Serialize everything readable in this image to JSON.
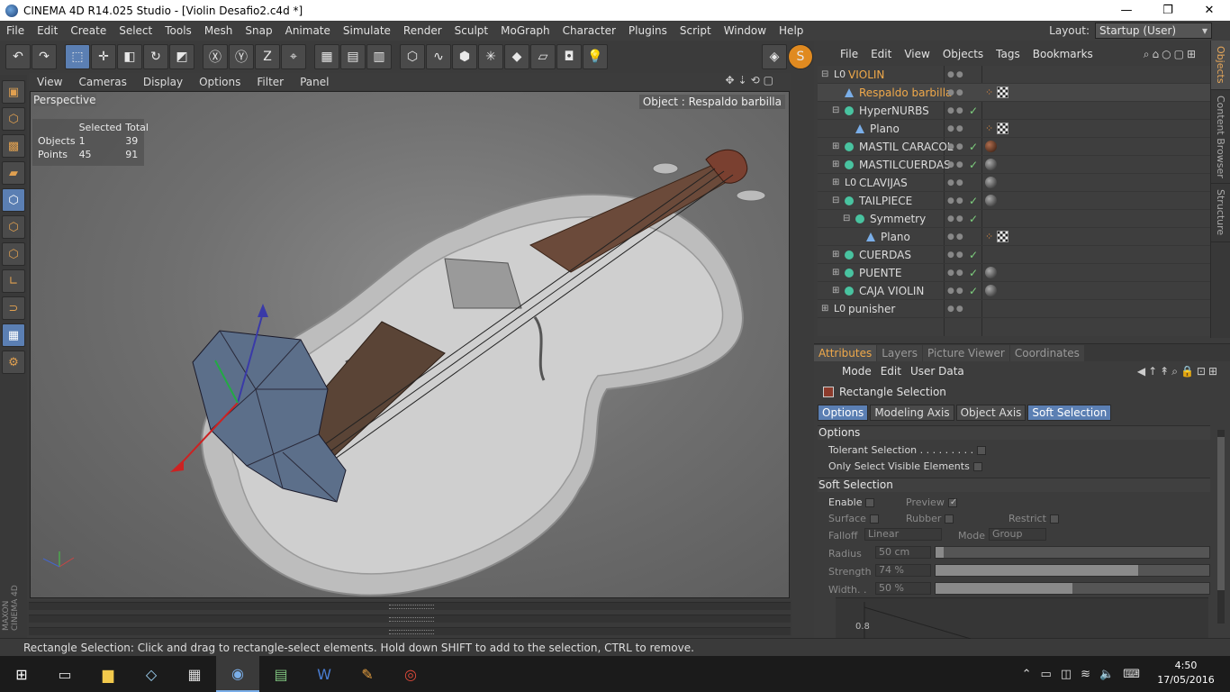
{
  "window": {
    "title": "CINEMA 4D R14.025 Studio - [Violin Desafio2.c4d *]",
    "minimize": "—",
    "maximize": "❐",
    "close": "✕"
  },
  "menubar": [
    "File",
    "Edit",
    "Create",
    "Select",
    "Tools",
    "Mesh",
    "Snap",
    "Animate",
    "Simulate",
    "Render",
    "Sculpt",
    "MoGraph",
    "Character",
    "Plugins",
    "Script",
    "Window",
    "Help"
  ],
  "layout": {
    "label": "Layout:",
    "value": "Startup (User)"
  },
  "viewport": {
    "menu": [
      "View",
      "Cameras",
      "Display",
      "Options",
      "Filter",
      "Panel"
    ],
    "label": "Perspective",
    "object_label": "Object : Respaldo barbilla",
    "stats": {
      "header_selected": "Selected",
      "header_total": "Total",
      "rows": [
        {
          "label": "Objects",
          "selected": "1",
          "total": "39"
        },
        {
          "label": "Points",
          "selected": "45",
          "total": "91"
        }
      ]
    },
    "brand": "MAXON CINEMA 4D"
  },
  "object_manager": {
    "menu": [
      "File",
      "Edit",
      "View",
      "Objects",
      "Tags",
      "Bookmarks"
    ],
    "side_tabs": [
      "Objects",
      "Content Browser",
      "Structure"
    ],
    "objects": [
      {
        "name": "VIOLIN",
        "indent": 0,
        "icon": "null",
        "expand": "⊟",
        "highlight": true,
        "check": "",
        "tags": []
      },
      {
        "name": "Respaldo barbilla",
        "indent": 1,
        "icon": "poly",
        "expand": "",
        "highlight": true,
        "check": "",
        "tags": [
          "phong",
          "chk"
        ]
      },
      {
        "name": "HyperNURBS",
        "indent": 1,
        "icon": "gen",
        "expand": "⊟",
        "highlight": false,
        "check": "✓",
        "tags": []
      },
      {
        "name": "Plano",
        "indent": 2,
        "icon": "poly",
        "expand": "",
        "highlight": false,
        "check": "",
        "tags": [
          "phong",
          "chk"
        ]
      },
      {
        "name": "MASTIL CARACOL",
        "indent": 1,
        "icon": "gen",
        "expand": "⊞",
        "highlight": false,
        "check": "✓",
        "tags": [
          "brown"
        ]
      },
      {
        "name": "MASTILCUERDAS",
        "indent": 1,
        "icon": "gen",
        "expand": "⊞",
        "highlight": false,
        "check": "✓",
        "tags": [
          "dark"
        ]
      },
      {
        "name": "CLAVIJAS",
        "indent": 1,
        "icon": "null",
        "expand": "⊞",
        "highlight": false,
        "check": "",
        "tags": [
          "dark"
        ]
      },
      {
        "name": "TAILPIECE",
        "indent": 1,
        "icon": "gen",
        "expand": "⊟",
        "highlight": false,
        "check": "✓",
        "tags": [
          "dark"
        ]
      },
      {
        "name": "Symmetry",
        "indent": 2,
        "icon": "gen",
        "expand": "⊟",
        "highlight": false,
        "check": "✓",
        "tags": []
      },
      {
        "name": "Plano",
        "indent": 3,
        "icon": "poly",
        "expand": "",
        "highlight": false,
        "check": "",
        "tags": [
          "phong",
          "chk"
        ]
      },
      {
        "name": "CUERDAS",
        "indent": 1,
        "icon": "gen",
        "expand": "⊞",
        "highlight": false,
        "check": "✓",
        "tags": []
      },
      {
        "name": "PUENTE",
        "indent": 1,
        "icon": "gen",
        "expand": "⊞",
        "highlight": false,
        "check": "✓",
        "tags": [
          "dark"
        ]
      },
      {
        "name": "CAJA VIOLIN",
        "indent": 1,
        "icon": "gen",
        "expand": "⊞",
        "highlight": false,
        "check": "✓",
        "tags": [
          "dark"
        ]
      },
      {
        "name": "punisher",
        "indent": 0,
        "icon": "null",
        "expand": "⊞",
        "highlight": false,
        "check": "",
        "tags": []
      }
    ]
  },
  "attributes": {
    "tabs": [
      "Attributes",
      "Layers",
      "Picture Viewer",
      "Coordinates"
    ],
    "menu": [
      "Mode",
      "Edit",
      "User Data"
    ],
    "tool_title": "Rectangle Selection",
    "subtabs": [
      "Options",
      "Modeling Axis",
      "Object Axis",
      "Soft Selection"
    ],
    "options_header": "Options",
    "tolerant": "Tolerant Selection . . . . . . . . .",
    "only_visible": "Only Select Visible Elements",
    "soft_header": "Soft Selection",
    "enable": "Enable",
    "preview": "Preview",
    "surface": "Surface",
    "rubber": "Rubber",
    "restrict": "Restrict",
    "falloff_label": "Falloff",
    "falloff_value": "Linear",
    "mode_label": "Mode",
    "mode_value": "Group",
    "radius_label": "Radius",
    "radius_value": "50 cm",
    "radius_fraction": 0.03,
    "strength_label": "Strength",
    "strength_value": "74 %",
    "strength_fraction": 0.74,
    "width_label": "Width. .",
    "width_value": "50 %",
    "width_fraction": 0.5,
    "curve_label": "0.8"
  },
  "status": "Rectangle Selection: Click and drag to rectangle-select elements. Hold down SHIFT to add to the selection, CTRL to remove.",
  "taskbar": {
    "time": "4:50",
    "date": "17/05/2016"
  }
}
